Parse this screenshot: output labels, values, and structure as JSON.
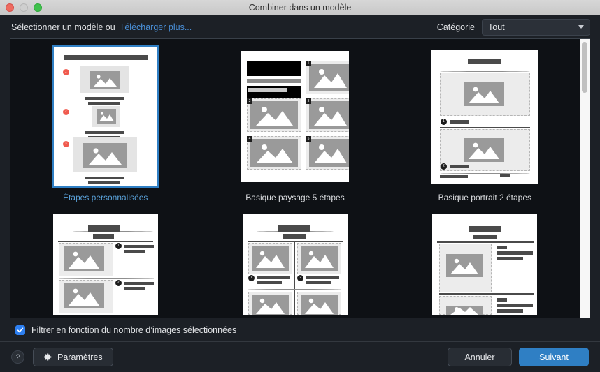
{
  "window": {
    "title": "Combiner dans un modèle",
    "controls": [
      "close-button",
      "minimize-button",
      "zoom-button"
    ]
  },
  "header": {
    "label": "Sélectionner un modèle ou",
    "link": "Télécharger plus...",
    "category_label": "Catégorie",
    "category_value": "Tout",
    "category_caret": "chevron-down-icon"
  },
  "templates": [
    {
      "id": "custom-steps",
      "caption": "Étapes personnalisées",
      "selected": true
    },
    {
      "id": "basic-landscape-5",
      "caption": "Basique paysage 5 étapes",
      "selected": false
    },
    {
      "id": "basic-portrait-2",
      "caption": "Basique portrait 2 étapes",
      "selected": false
    },
    {
      "id": "row2-left",
      "caption": "",
      "selected": false
    },
    {
      "id": "row2-center",
      "caption": "",
      "selected": false
    },
    {
      "id": "row2-right",
      "caption": "",
      "selected": false
    }
  ],
  "filter": {
    "checked": true,
    "label": "Filtrer en fonction du nombre d’images sélectionnées"
  },
  "footer": {
    "help_label": "?",
    "settings_label": "Paramètres",
    "settings_icon": "gear-icon",
    "cancel_label": "Annuler",
    "next_label": "Suivant"
  },
  "colors": {
    "accent": "#2f7fc4",
    "link": "#4a90d9",
    "checkbox": "#2d7ff0",
    "window_bg": "#1c2026",
    "panel_bg": "#0e1115",
    "badge_red": "#f05a4e"
  }
}
